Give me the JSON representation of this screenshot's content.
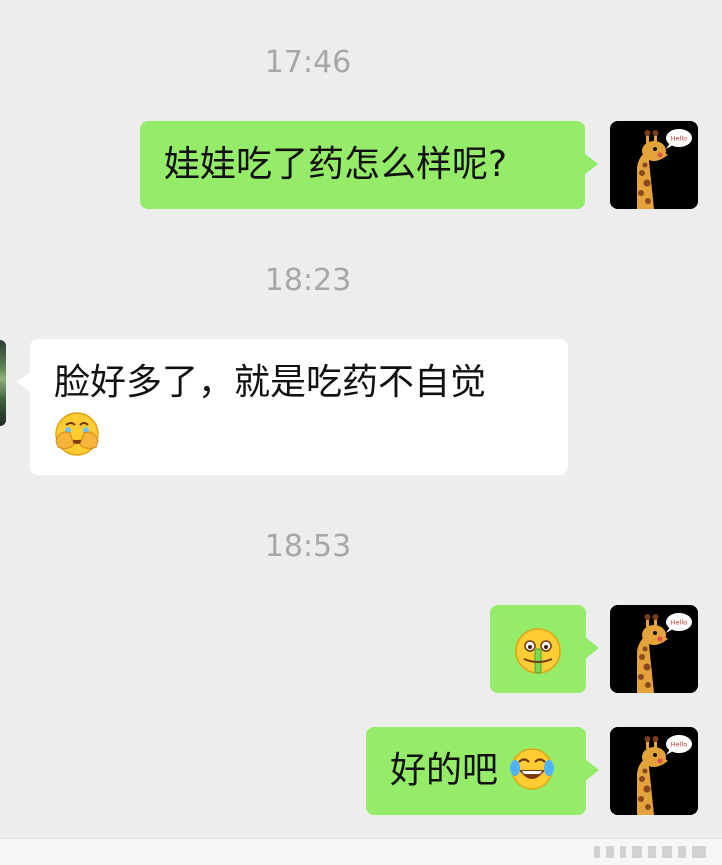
{
  "timestamps": [
    "17:46",
    "18:23",
    "18:53"
  ],
  "messages": [
    {
      "side": "me",
      "text": "娃娃吃了药怎么样呢?"
    },
    {
      "side": "them",
      "line1": "脸好多了，就是吃药不自觉",
      "emoji": "facepalm-laugh-emoji"
    },
    {
      "side": "me",
      "emoji": "zipper-mouth-emoji"
    },
    {
      "side": "me",
      "text": "好的吧",
      "emoji": "tears-of-joy-emoji"
    }
  ],
  "avatar": {
    "icon": "giraffe-avatar-icon",
    "bubble_text": "Hello"
  },
  "colors": {
    "background": "#ededed",
    "me_bubble": "#95ec69",
    "them_bubble": "#ffffff",
    "timestamp": "#a7a7a7",
    "emoji_yellow": "#ffcc33"
  }
}
